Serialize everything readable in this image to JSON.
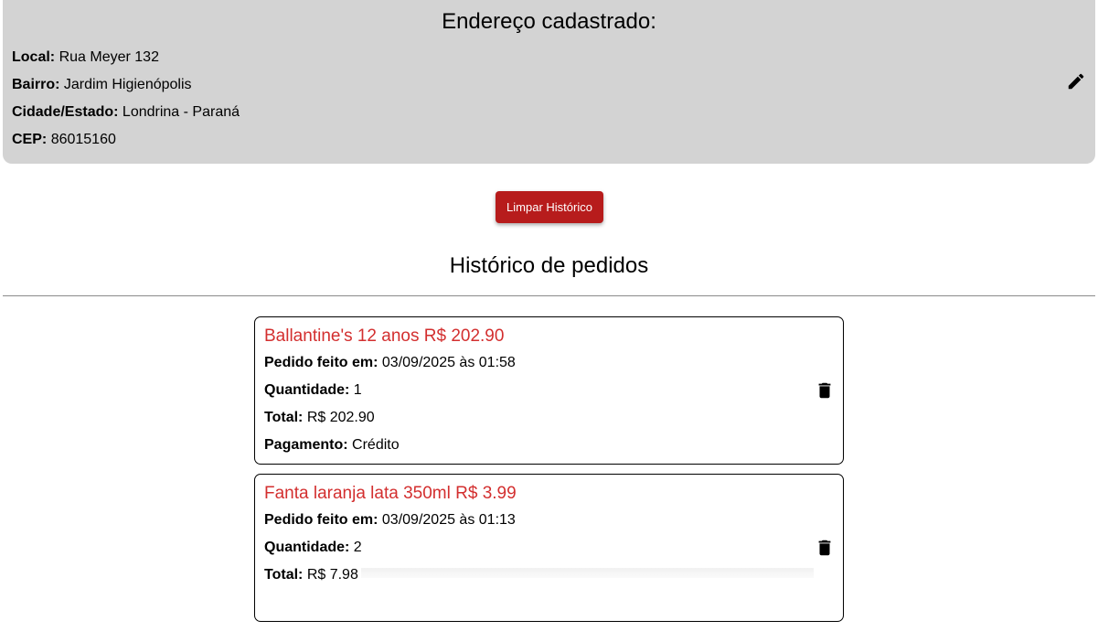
{
  "address": {
    "title": "Endereço cadastrado:",
    "fields": [
      {
        "label": "Local:",
        "value": "Rua Meyer 132"
      },
      {
        "label": "Bairro:",
        "value": "Jardim Higienópolis"
      },
      {
        "label": "Cidade/Estado:",
        "value": "Londrina - Paraná"
      },
      {
        "label": "CEP:",
        "value": "86015160"
      }
    ],
    "edit_icon": "pencil-icon"
  },
  "actions": {
    "clear_history_label": "Limpar Histórico",
    "clear_history_color": "#b71c1c"
  },
  "history": {
    "title": "Histórico de pedidos",
    "labels": {
      "date": "Pedido feito em:",
      "quantity": "Quantidade:",
      "total": "Total:",
      "payment": "Pagamento:"
    },
    "orders": [
      {
        "title": "Ballantine's 12 anos R$ 202.90",
        "date": "03/09/2025 às 01:58",
        "quantity": "1",
        "total": "R$ 202.90",
        "payment": "Crédito"
      },
      {
        "title": "Fanta laranja lata 350ml R$ 3.99",
        "date": "03/09/2025 às 01:13",
        "quantity": "2",
        "total": "R$ 7.98",
        "payment": ""
      }
    ],
    "title_color": "#d32f2f",
    "delete_icon": "trash-icon"
  }
}
